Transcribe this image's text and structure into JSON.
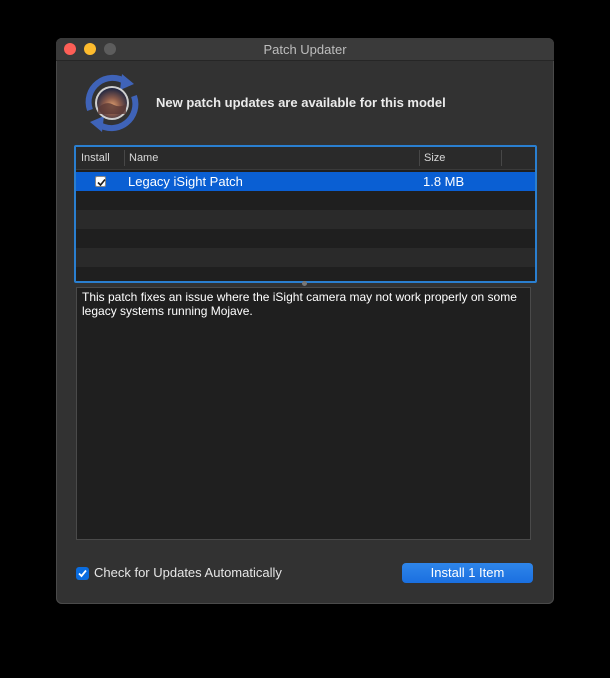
{
  "window": {
    "title": "Patch Updater"
  },
  "header": {
    "message": "New patch updates are available for this model",
    "app_icon": "patch-updater-app-icon"
  },
  "table": {
    "columns": [
      "Install",
      "Name",
      "Size"
    ],
    "rows": [
      {
        "install": true,
        "name": "Legacy iSight Patch",
        "size": "1.8 MB",
        "selected": true
      }
    ]
  },
  "description": {
    "text": "This patch fixes an issue where the iSight camera may not work properly on some legacy systems running Mojave."
  },
  "footer": {
    "auto_check_label": "Check for Updates Automatically",
    "auto_check_enabled": true,
    "install_button_label": "Install 1 Item"
  },
  "colors": {
    "accent": "#0a5fd3",
    "close": "#fe5f57",
    "minimize": "#febc2e",
    "zoom_disabled": "#5d5d5d"
  }
}
